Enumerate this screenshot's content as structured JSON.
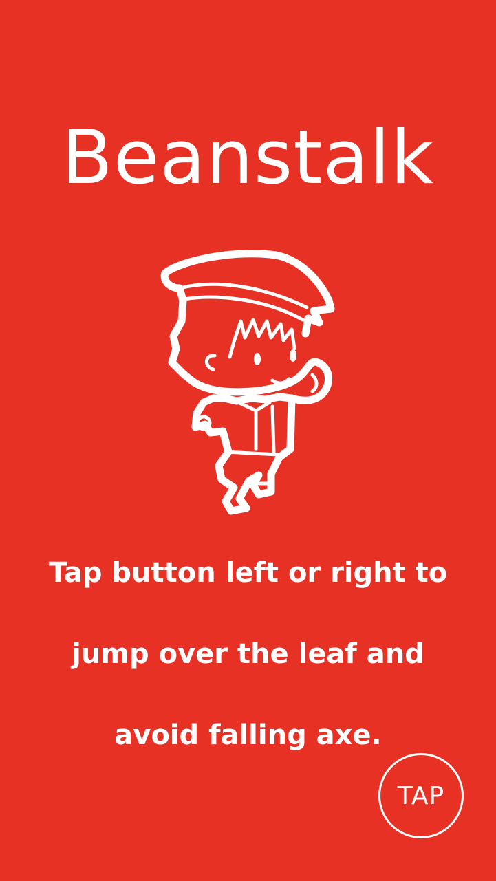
{
  "game": {
    "title": "Beanstalk",
    "character_icon": "boy-with-cap-icon",
    "instructions": [
      "Tap button left or right to",
      "jump over the leaf and",
      "avoid falling axe."
    ],
    "tap_button_label": "TAP"
  },
  "colors": {
    "background": "#e83125",
    "foreground": "#ffffff"
  }
}
